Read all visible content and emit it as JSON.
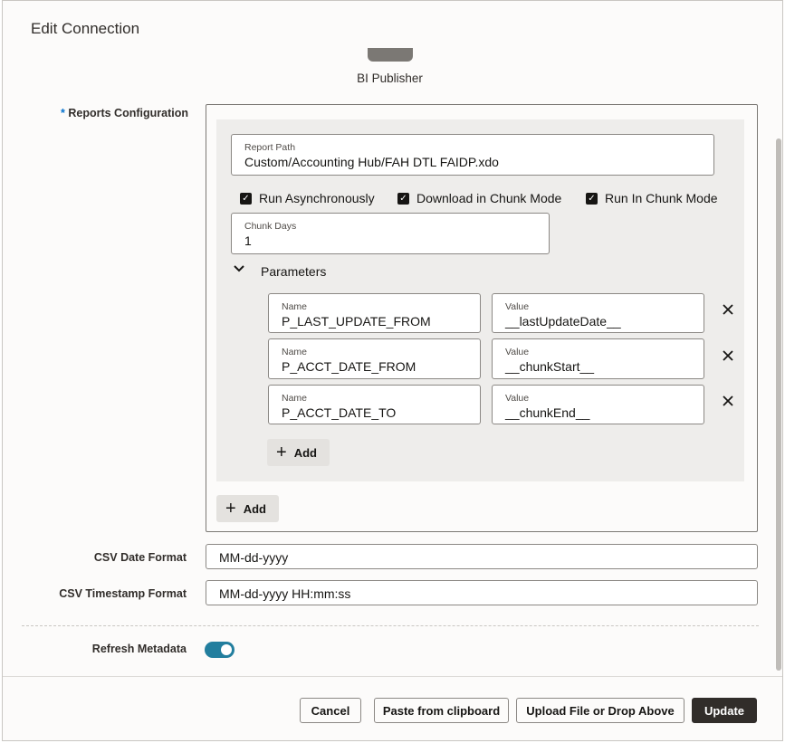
{
  "dialog": {
    "title": "Edit Connection",
    "connector_label": "BI Publisher"
  },
  "reports": {
    "label": "Reports Configuration",
    "required_marker": "*",
    "report_path": {
      "label": "Report Path",
      "value": "Custom/Accounting Hub/FAH DTL FAIDP.xdo"
    },
    "checkboxes": [
      {
        "label": "Run Asynchronously",
        "checked": true
      },
      {
        "label": "Download in Chunk Mode",
        "checked": true
      },
      {
        "label": "Run In Chunk Mode",
        "checked": true
      }
    ],
    "chunk_days": {
      "label": "Chunk Days",
      "value": "1"
    },
    "parameters": {
      "label": "Parameters",
      "rows": [
        {
          "name_label": "Name",
          "name": "P_LAST_UPDATE_FROM",
          "value_label": "Value",
          "value": "__lastUpdateDate__"
        },
        {
          "name_label": "Name",
          "name": "P_ACCT_DATE_FROM",
          "value_label": "Value",
          "value": "__chunkStart__"
        },
        {
          "name_label": "Name",
          "name": "P_ACCT_DATE_TO",
          "value_label": "Value",
          "value": "__chunkEnd__"
        }
      ],
      "add_label": "Add"
    },
    "add_label": "Add"
  },
  "csv_date_format": {
    "label": "CSV Date Format",
    "value": "MM-dd-yyyy"
  },
  "csv_timestamp_format": {
    "label": "CSV Timestamp Format",
    "value": "MM-dd-yyyy HH:mm:ss"
  },
  "refresh_metadata": {
    "label": "Refresh Metadata",
    "enabled": true
  },
  "footer": {
    "cancel": "Cancel",
    "paste": "Paste from clipboard",
    "upload": "Upload File or Drop Above",
    "update": "Update"
  },
  "colors": {
    "accent": "#227e9e",
    "primary_button": "#312d2a"
  }
}
